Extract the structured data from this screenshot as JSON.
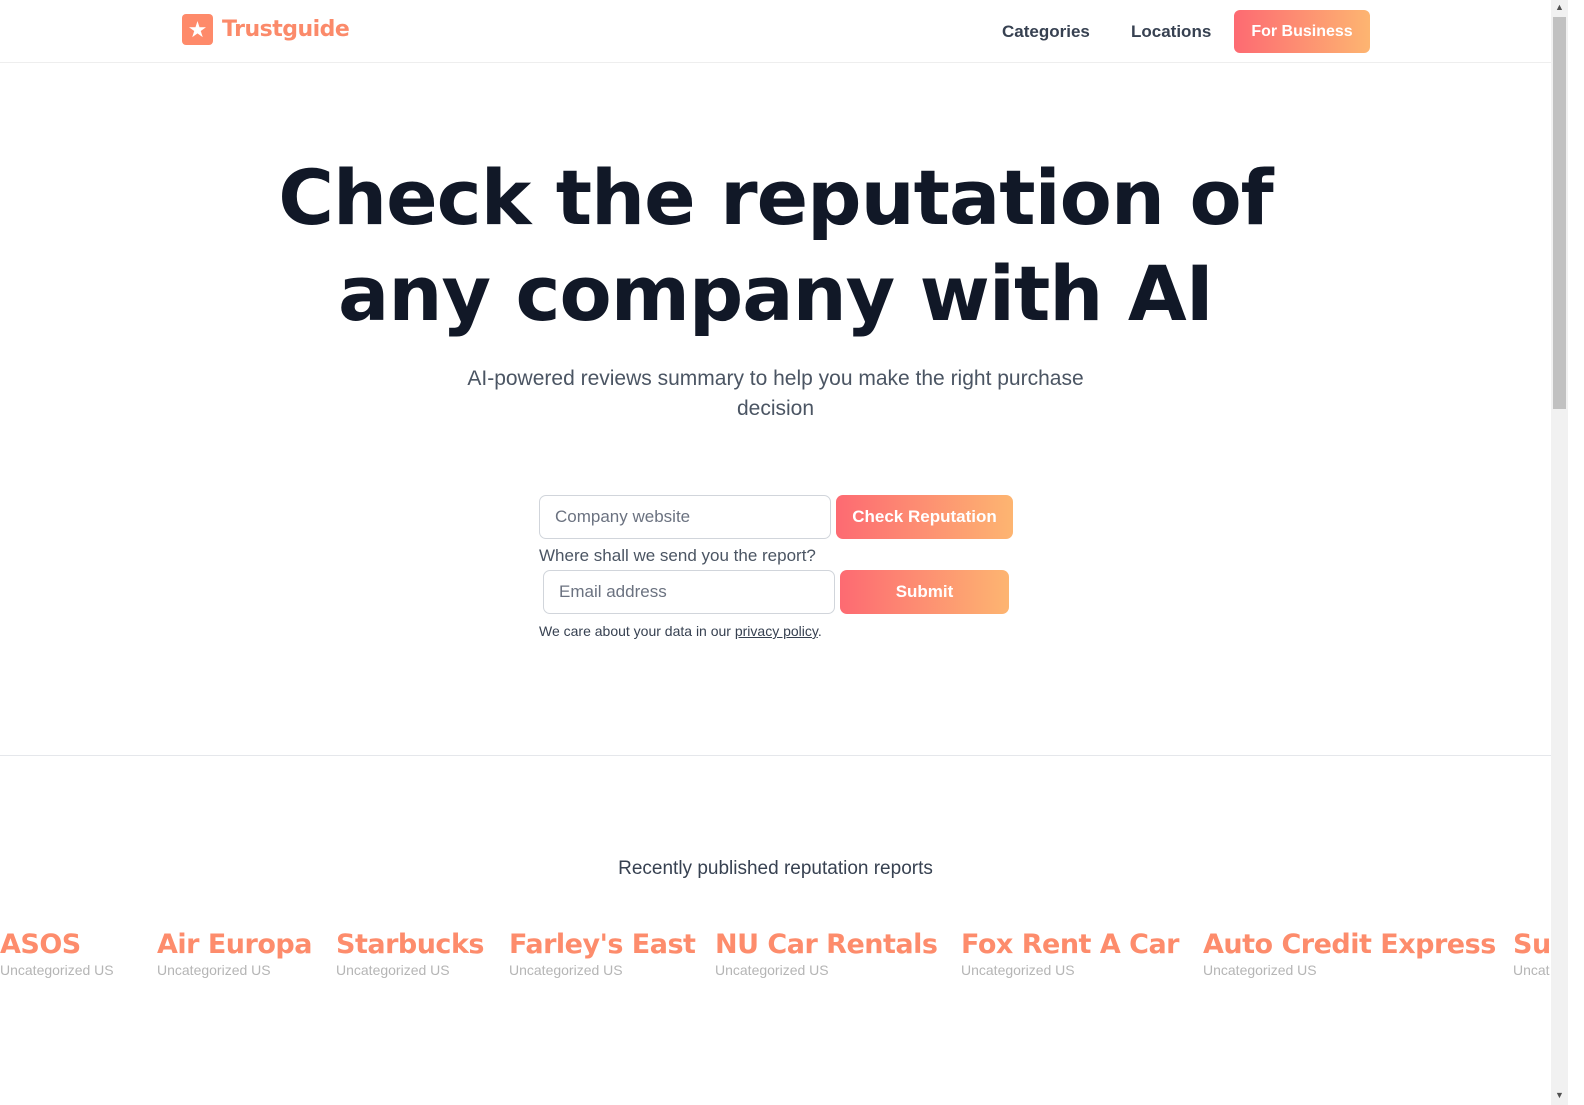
{
  "header": {
    "brand": "Trustguide",
    "nav": [
      "Categories",
      "Locations"
    ],
    "cta": "For Business"
  },
  "hero": {
    "title_line1": "Check the reputation of",
    "title_line2": "any company with AI",
    "subtitle": "AI-powered reviews summary to help you make the right purchase decision"
  },
  "form": {
    "website_placeholder": "Company website",
    "check_label": "Check Reputation",
    "email_prompt": "Where shall we send you the report?",
    "email_placeholder": "Email address",
    "submit_label": "Submit",
    "privacy_prefix": "We care about your data in our ",
    "privacy_link": "privacy policy",
    "privacy_suffix": "."
  },
  "recent": {
    "heading": "Recently published reputation reports",
    "companies": [
      {
        "name": "ASOS",
        "category": "Uncategorized US"
      },
      {
        "name": "Air Europa",
        "category": "Uncategorized US"
      },
      {
        "name": "Starbucks",
        "category": "Uncategorized US"
      },
      {
        "name": "Farley's East",
        "category": "Uncategorized US"
      },
      {
        "name": "NU Car Rentals",
        "category": "Uncategorized US"
      },
      {
        "name": "Fox Rent A Car",
        "category": "Uncategorized US"
      },
      {
        "name": "Auto Credit Express",
        "category": "Uncategorized US"
      },
      {
        "name": "Su",
        "category": "Uncat"
      }
    ]
  },
  "colors": {
    "brand": "#fd8c6c",
    "gradient_start": "#fd6a72",
    "gradient_end": "#fdb571",
    "text": "#111827"
  },
  "icons": {
    "logo": "star-icon"
  }
}
